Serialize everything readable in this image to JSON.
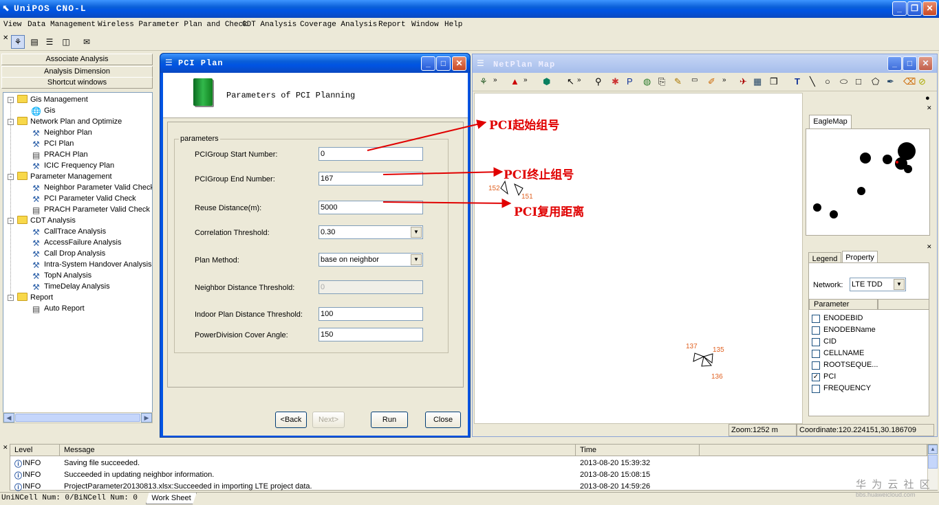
{
  "app": {
    "title": "UniPOS CNO-L",
    "min": "_",
    "max": "❐",
    "close": "✕"
  },
  "menu": [
    "View",
    "Data Management",
    "Wireless Parameter Plan and Check",
    "CDT Analysis",
    "Coverage Analysis",
    "Report",
    "Window",
    "Help"
  ],
  "left": {
    "buttons": [
      "Associate Analysis",
      "Analysis Dimension",
      "Shortcut windows"
    ],
    "tree": [
      {
        "label": "Gis Management",
        "level": 0,
        "type": "folder",
        "exp": "-"
      },
      {
        "label": "Gis",
        "level": 1,
        "type": "globe"
      },
      {
        "label": "Network Plan and Optimize",
        "level": 0,
        "type": "folder",
        "exp": "-"
      },
      {
        "label": "Neighbor Plan",
        "level": 1,
        "type": "tool"
      },
      {
        "label": "PCI Plan",
        "level": 1,
        "type": "tool"
      },
      {
        "label": "PRACH Plan",
        "level": 1,
        "type": "doc"
      },
      {
        "label": "ICIC Frequency Plan",
        "level": 1,
        "type": "tool"
      },
      {
        "label": "Parameter Management",
        "level": 0,
        "type": "folder",
        "exp": "-"
      },
      {
        "label": "Neighbor Parameter Valid Check",
        "level": 1,
        "type": "tool"
      },
      {
        "label": "PCI Parameter Valid Check",
        "level": 1,
        "type": "tool"
      },
      {
        "label": "PRACH Parameter Valid Check",
        "level": 1,
        "type": "doc"
      },
      {
        "label": "CDT Analysis",
        "level": 0,
        "type": "folder",
        "exp": "-"
      },
      {
        "label": "CallTrace Analysis",
        "level": 1,
        "type": "tool"
      },
      {
        "label": "AccessFailure Analysis",
        "level": 1,
        "type": "tool"
      },
      {
        "label": "Call Drop Analysis",
        "level": 1,
        "type": "tool"
      },
      {
        "label": "Intra-System Handover Analysis",
        "level": 1,
        "type": "tool"
      },
      {
        "label": "TopN Analysis",
        "level": 1,
        "type": "tool"
      },
      {
        "label": "TimeDelay Analysis",
        "level": 1,
        "type": "tool"
      },
      {
        "label": "Report",
        "level": 0,
        "type": "folder",
        "exp": "-"
      },
      {
        "label": "Auto Report",
        "level": 1,
        "type": "doc"
      }
    ]
  },
  "dialog": {
    "title": "PCI Plan",
    "header": "Parameters of  PCI Planning",
    "group": "parameters",
    "fields": [
      {
        "label": "PCIGroup Start Number:",
        "value": "0",
        "kind": "input"
      },
      {
        "label": "PCIGroup End Number:",
        "value": "167",
        "kind": "input"
      },
      {
        "label": "Reuse Distance(m):",
        "value": "5000",
        "kind": "input"
      },
      {
        "label": "Correlation Threshold:",
        "value": "0.30",
        "kind": "select"
      },
      {
        "label": "Plan Method:",
        "value": "base on neighbor",
        "kind": "select"
      },
      {
        "label": "Neighbor Distance Threshold:",
        "value": "0",
        "kind": "disabled"
      },
      {
        "label": "Indoor Plan Distance Threshold:",
        "value": "100",
        "kind": "input"
      },
      {
        "label": "PowerDivision Cover Angle:",
        "value": "150",
        "kind": "input"
      }
    ],
    "buttons": {
      "back": "<Back",
      "next": "Next>",
      "run": "Run",
      "close": "Close"
    }
  },
  "map": {
    "title": "NetPlan Map",
    "cells": [
      "152",
      "151",
      "137",
      "135",
      "136"
    ],
    "eagle_tab": "EagleMap",
    "legend_tab": "Legend",
    "property_tab": "Property",
    "network_label": "Network:",
    "network_value": "LTE TDD",
    "param_header": "Parameter",
    "params": [
      {
        "name": "ENODEBID",
        "checked": false
      },
      {
        "name": "ENODEBName",
        "checked": false
      },
      {
        "name": "CID",
        "checked": false
      },
      {
        "name": "CELLNAME",
        "checked": false
      },
      {
        "name": "ROOTSEQUE...",
        "checked": false
      },
      {
        "name": "PCI",
        "checked": true
      },
      {
        "name": "FREQUENCY",
        "checked": false
      }
    ],
    "zoom": "Zoom:1252 m",
    "coordinate": "Coordinate:120.224151,30.186709"
  },
  "annotations": [
    "PCI起始组号",
    "PCI终止组号",
    "PCI复用距离"
  ],
  "log": {
    "headers": [
      "Level",
      "Message",
      "Time"
    ],
    "rows": [
      {
        "level": "INFO",
        "message": "Saving file succeeded.",
        "time": "2013-08-20 15:39:32"
      },
      {
        "level": "INFO",
        "message": "Succeeded in updating neighbor information.",
        "time": "2013-08-20 15:08:15"
      },
      {
        "level": "INFO",
        "message": "ProjectParameter20130813.xlsx:Succeeded in importing LTE project data.",
        "time": "2013-08-20 14:59:26"
      }
    ]
  },
  "status": {
    "cells": "UniNCell Num: 0/BiNCell Num: 0",
    "sheet": "Work Sheet"
  },
  "watermark": {
    "cn": "华 为 云 社 区",
    "url": "bbs.huaweicloud.com"
  }
}
